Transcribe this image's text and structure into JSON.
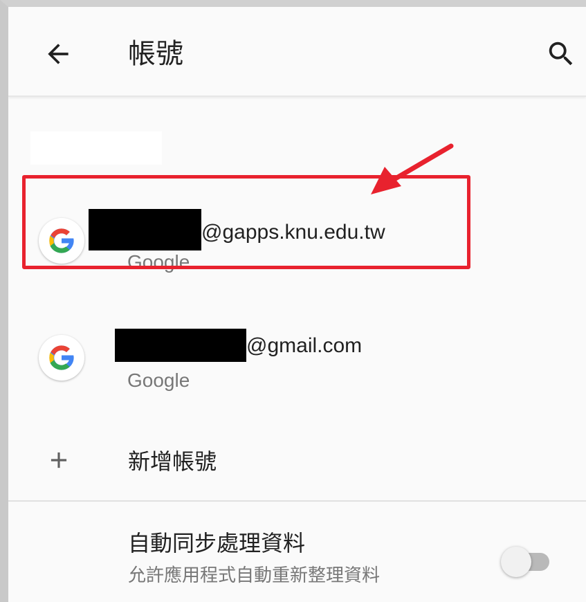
{
  "appbar": {
    "title": "帳號",
    "back_icon": "arrow-back-icon",
    "search_icon": "search-icon"
  },
  "accounts": [
    {
      "email_suffix": "@gapps.knu.edu.tw",
      "provider": "Google",
      "icon": "google-g-icon",
      "highlighted": true
    },
    {
      "email_suffix": "@gmail.com",
      "provider": "Google",
      "icon": "google-g-icon",
      "highlighted": false
    }
  ],
  "add_account": {
    "label": "新增帳號",
    "icon": "plus-icon"
  },
  "sync": {
    "title": "自動同步處理資料",
    "subtitle": "允許應用程式自動重新整理資料",
    "enabled": false
  },
  "colors": {
    "annotation_red": "#e8222e",
    "google_blue": "#4285F4",
    "google_red": "#EA4335",
    "google_yellow": "#FBBC05",
    "google_green": "#34A853"
  }
}
